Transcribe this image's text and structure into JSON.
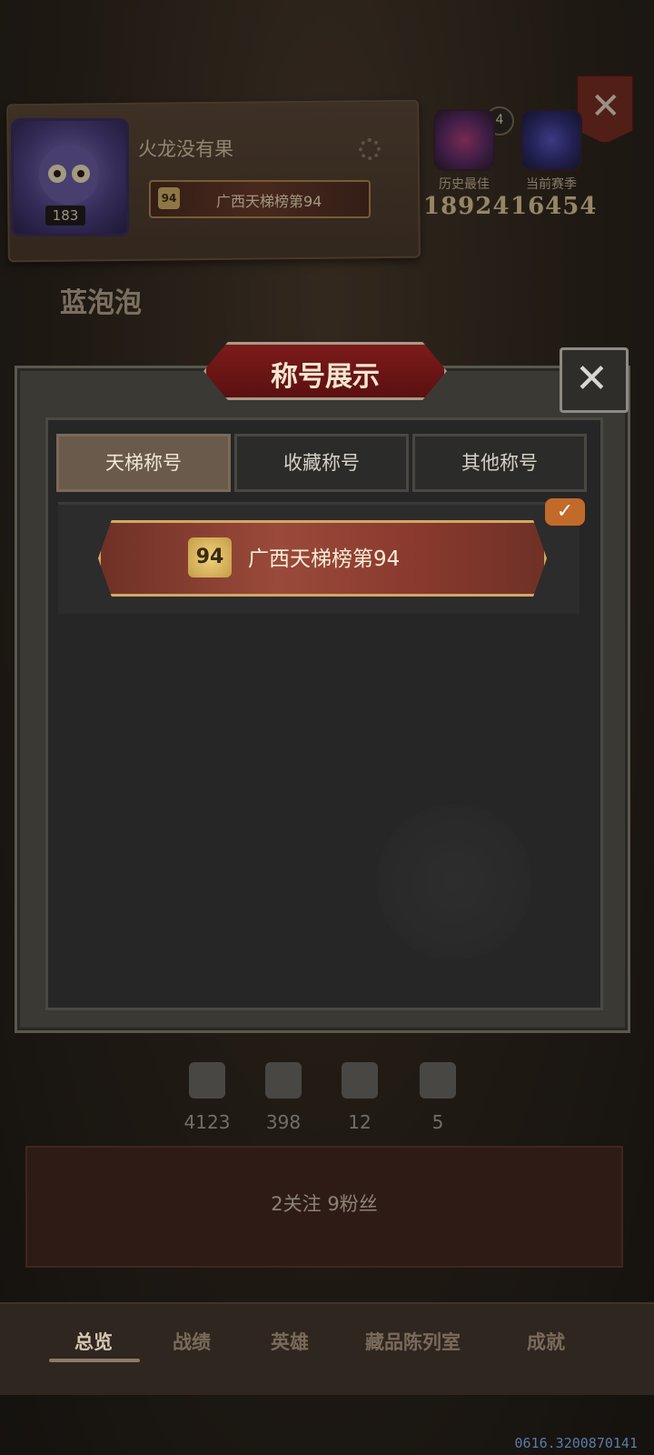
{
  "profile": {
    "name": "火龙没有果",
    "avatar_level": "183",
    "title_badge": {
      "number": "94",
      "text": "广西天梯榜第94"
    }
  },
  "ranks": {
    "crown_count": "4",
    "best": {
      "label": "历史最佳",
      "value": "18924"
    },
    "current": {
      "label": "当前赛季",
      "value": "16454"
    }
  },
  "player_nickname": "蓝泡泡",
  "modal": {
    "title": "称号展示",
    "tabs": [
      {
        "label": "天梯称号",
        "active": true
      },
      {
        "label": "收藏称号",
        "active": false
      },
      {
        "label": "其他称号",
        "active": false
      }
    ],
    "selected_title": {
      "number": "94",
      "text": "广西天梯榜第94"
    }
  },
  "stats": [
    {
      "icon": "swords-icon",
      "value": "4123"
    },
    {
      "icon": "crown-icon",
      "value": "398"
    },
    {
      "icon": "card-icon",
      "value": "12"
    },
    {
      "icon": "checkerboard-icon",
      "value": "5"
    }
  ],
  "follow": {
    "text": "2关注   9粉丝"
  },
  "nav": {
    "items": [
      {
        "label": "总览",
        "active": true
      },
      {
        "label": "战绩",
        "active": false
      },
      {
        "label": "英雄",
        "active": false
      },
      {
        "label": "藏品陈列室",
        "active": false
      },
      {
        "label": "成就",
        "active": false
      }
    ]
  },
  "footer_id": "0616.3200870141",
  "colors": {
    "accent_red": "#7d1b1b",
    "gold": "#d3a763",
    "checkmark": "#c26a2a"
  }
}
